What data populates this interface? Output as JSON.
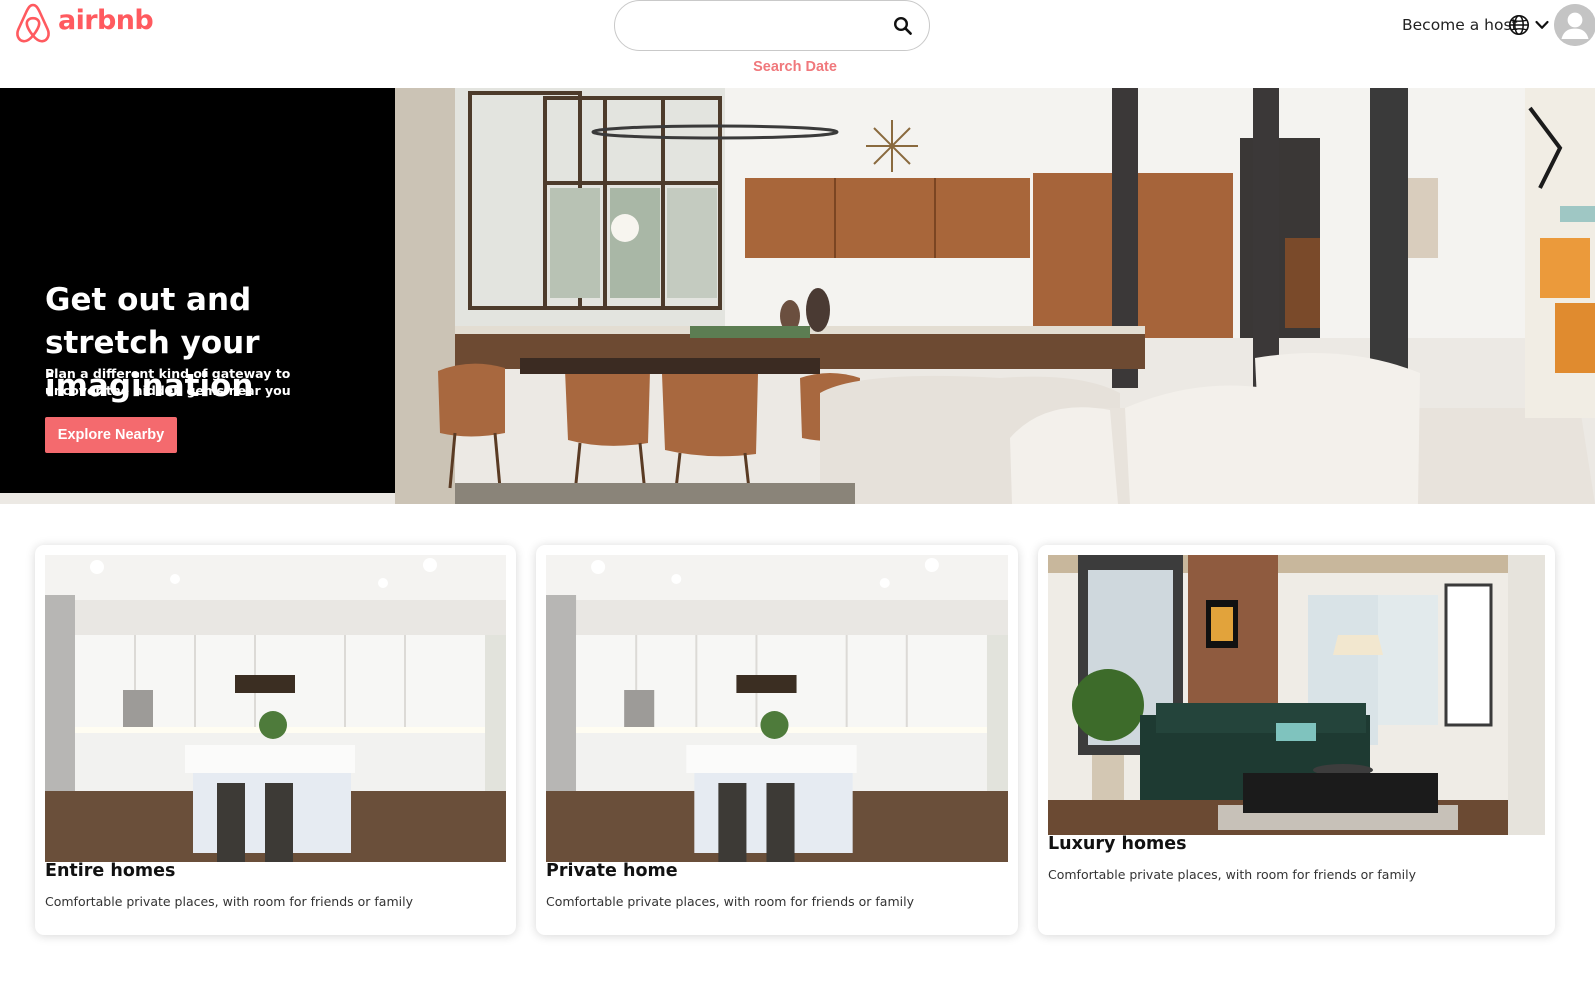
{
  "header": {
    "logo_text": "airbnb",
    "search": {
      "value": "",
      "placeholder": ""
    },
    "search_date_label": "Search Date",
    "become_host_label": "Become a host",
    "icons": [
      "airbnb-logo-icon",
      "search-icon",
      "globe-icon",
      "chevron-down-icon",
      "user-avatar-icon"
    ]
  },
  "hero": {
    "title": "Get out and stretch your imagination",
    "subtitle": "Plan a different kind of gateway to uncover the hidden gems near you",
    "button_label": "Explore Nearby"
  },
  "cards": [
    {
      "title": "Entire homes",
      "description": "Comfortable private places, with room for friends or family"
    },
    {
      "title": "Private home",
      "description": "Comfortable private places, with room for friends or family"
    },
    {
      "title": "Luxury homes",
      "description": "Comfortable private places, with room for friends or family"
    }
  ],
  "colors": {
    "brand": "#ff5a5f",
    "search_date": "#f0787c",
    "button": "#f46a6e",
    "hero_panel": "#000000"
  }
}
